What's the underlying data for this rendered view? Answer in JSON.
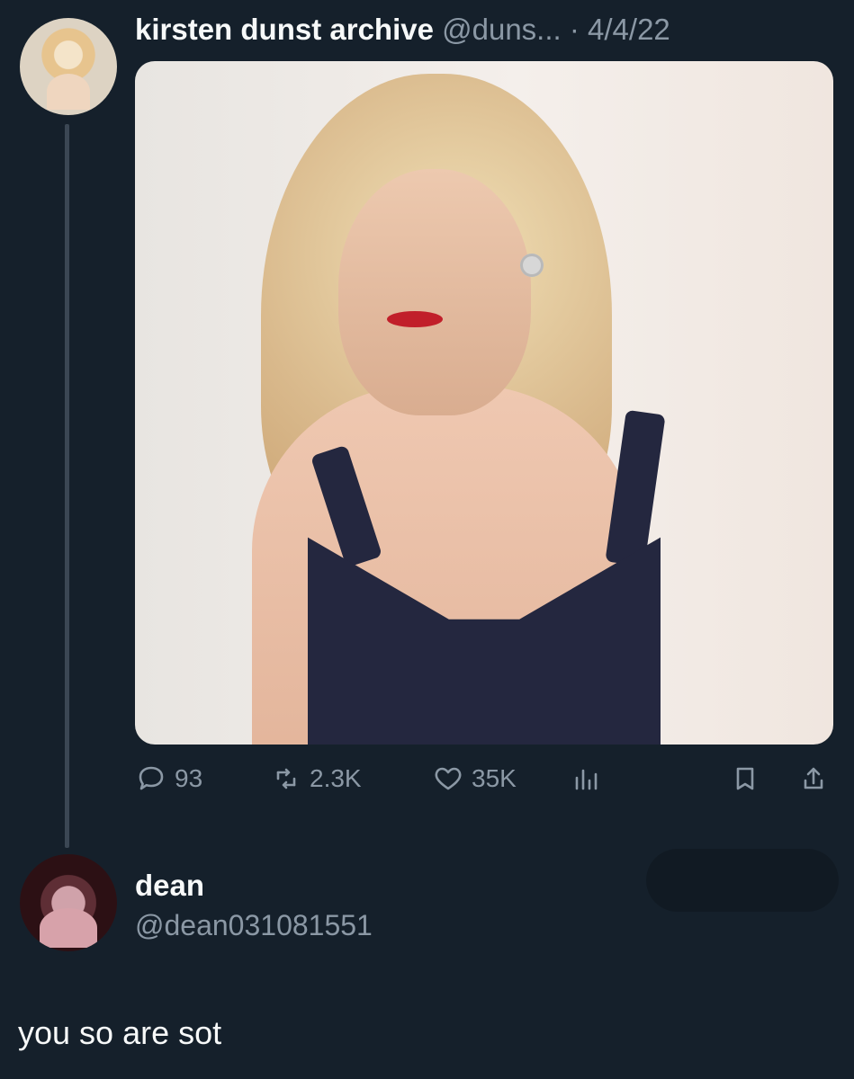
{
  "tweet": {
    "display_name": "kirsten dunst archive",
    "handle": "@duns...",
    "timestamp": "· 4/4/22",
    "metrics": {
      "replies": "93",
      "retweets": "2.3K",
      "likes": "35K"
    }
  },
  "reply": {
    "display_name": "dean",
    "handle": "@dean031081551",
    "text": "you so are sot"
  },
  "icons": {
    "reply": "comment-icon",
    "retweet": "retweet-icon",
    "like": "heart-icon",
    "views": "views-icon",
    "bookmark": "bookmark-icon",
    "share": "share-icon"
  },
  "colors": {
    "background": "#15202b",
    "text": "#f7f9f9",
    "muted": "#8b98a5",
    "thread_line": "#3b4754"
  }
}
